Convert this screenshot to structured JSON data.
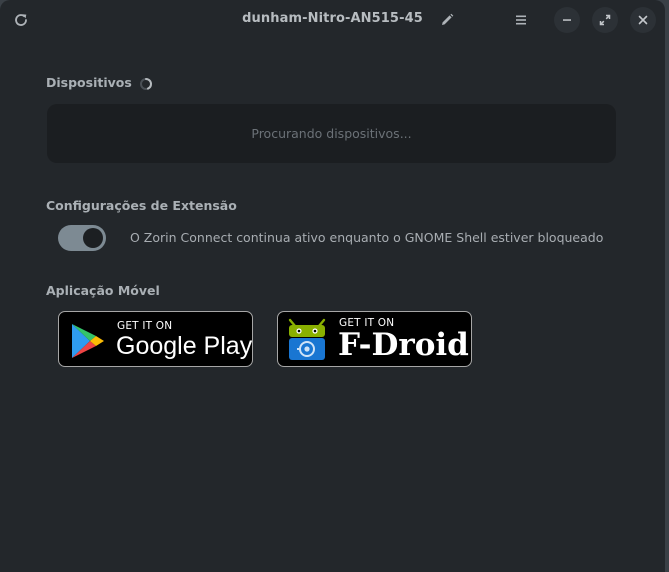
{
  "window": {
    "title": "dunham-Nitro-AN515-45"
  },
  "icons": {
    "refresh": "refresh-icon",
    "edit": "pencil-icon",
    "menu": "hamburger-menu-icon",
    "minimize": "minimize-icon",
    "maximize": "maximize-icon",
    "close": "close-icon"
  },
  "devices": {
    "heading": "Dispositivos",
    "placeholder": "Procurando dispositivos..."
  },
  "extension_settings": {
    "heading": "Configurações de Extensão",
    "lock_toggle": {
      "label": "O Zorin Connect continua ativo enquanto o GNOME Shell estiver bloqueado",
      "enabled": true
    }
  },
  "mobile_app": {
    "heading": "Aplicação Móvel",
    "google_play": {
      "small_text": "GET IT ON",
      "big_text": "Google Play"
    },
    "fdroid": {
      "small_text": "GET IT ON",
      "big_text": "F-Droid"
    }
  },
  "colors": {
    "window_bg": "#23272b",
    "box_bg": "#1b1e21",
    "toggle_on": "#7d8a93",
    "text": "#aab0b5"
  }
}
